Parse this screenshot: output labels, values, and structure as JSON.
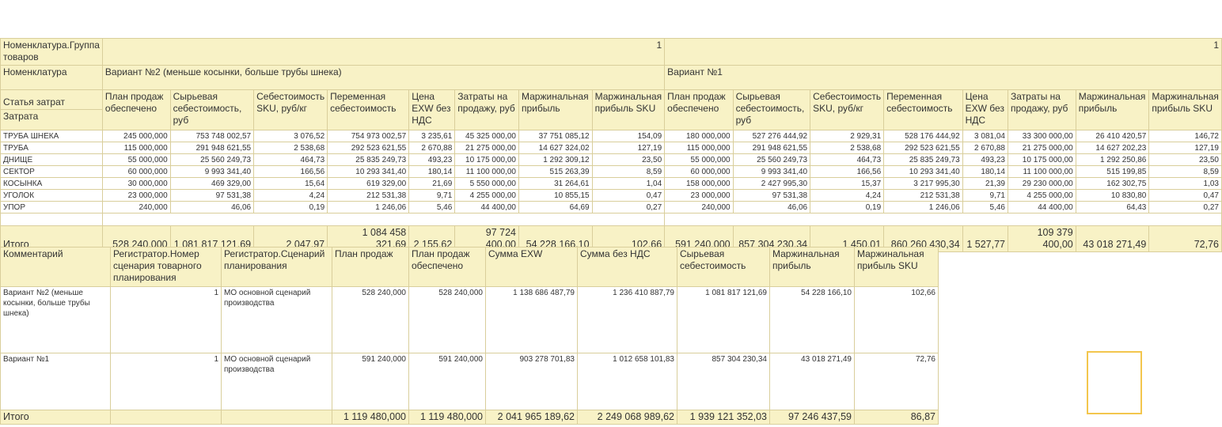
{
  "top_table": {
    "group_label": "Номенклатура.Группа товаров",
    "group_value_1": "1",
    "group_value_2": "1",
    "nomenclature_label": "Номенклатура",
    "variant_1": "Вариант №2 (меньше косынки, больше трубы шнека)",
    "variant_2": "Вариант №1",
    "stat_label": "Статья затрат",
    "zatrata_label": "Затрата",
    "col_headers": [
      "План продаж обеспечено",
      "Сырьевая себестоимость, руб",
      "Себестоимость SKU, руб/кг",
      "Переменная себестоимость",
      "Цена EXW без НДС",
      "Затраты на продажу, руб",
      "Маржинальная прибыль",
      "Маржинальная прибыль SKU"
    ],
    "rows": [
      {
        "name": "ТРУБА ШНЕКА",
        "v1": [
          "245 000,000",
          "753 748 002,57",
          "3 076,52",
          "754 973 002,57",
          "3 235,61",
          "45 325 000,00",
          "37 751 085,12",
          "154,09"
        ],
        "v2": [
          "180 000,000",
          "527 276 444,92",
          "2 929,31",
          "528 176 444,92",
          "3 081,04",
          "33 300 000,00",
          "26 410 420,57",
          "146,72"
        ]
      },
      {
        "name": "ТРУБА",
        "v1": [
          "115 000,000",
          "291 948 621,55",
          "2 538,68",
          "292 523 621,55",
          "2 670,88",
          "21 275 000,00",
          "14 627 324,02",
          "127,19"
        ],
        "v2": [
          "115 000,000",
          "291 948 621,55",
          "2 538,68",
          "292 523 621,55",
          "2 670,88",
          "21 275 000,00",
          "14 627 202,23",
          "127,19"
        ]
      },
      {
        "name": "ДНИЩЕ",
        "v1": [
          "55 000,000",
          "25 560 249,73",
          "464,73",
          "25 835 249,73",
          "493,23",
          "10 175 000,00",
          "1 292 309,12",
          "23,50"
        ],
        "v2": [
          "55 000,000",
          "25 560 249,73",
          "464,73",
          "25 835 249,73",
          "493,23",
          "10 175 000,00",
          "1 292 250,86",
          "23,50"
        ]
      },
      {
        "name": "СЕКТОР",
        "v1": [
          "60 000,000",
          "9 993 341,40",
          "166,56",
          "10 293 341,40",
          "180,14",
          "11 100 000,00",
          "515 263,39",
          "8,59"
        ],
        "v2": [
          "60 000,000",
          "9 993 341,40",
          "166,56",
          "10 293 341,40",
          "180,14",
          "11 100 000,00",
          "515 199,85",
          "8,59"
        ]
      },
      {
        "name": "КОСЫНКА",
        "v1": [
          "30 000,000",
          "469 329,00",
          "15,64",
          "619 329,00",
          "21,69",
          "5 550 000,00",
          "31 264,61",
          "1,04"
        ],
        "v2": [
          "158 000,000",
          "2 427 995,30",
          "15,37",
          "3 217 995,30",
          "21,39",
          "29 230 000,00",
          "162 302,75",
          "1,03"
        ]
      },
      {
        "name": "УГОЛОК",
        "v1": [
          "23 000,000",
          "97 531,38",
          "4,24",
          "212 531,38",
          "9,71",
          "4 255 000,00",
          "10 855,15",
          "0,47"
        ],
        "v2": [
          "23 000,000",
          "97 531,38",
          "4,24",
          "212 531,38",
          "9,71",
          "4 255 000,00",
          "10 830,80",
          "0,47"
        ]
      },
      {
        "name": "УПОР",
        "v1": [
          "240,000",
          "46,06",
          "0,19",
          "1 246,06",
          "5,46",
          "44 400,00",
          "64,69",
          "0,27"
        ],
        "v2": [
          "240,000",
          "46,06",
          "0,19",
          "1 246,06",
          "5,46",
          "44 400,00",
          "64,43",
          "0,27"
        ]
      }
    ],
    "total_label": "Итого",
    "total_v1": [
      "528 240,000",
      "1 081 817 121,69",
      "2 047,97",
      "1 084 458 321,69",
      "2 155,62",
      "97 724 400,00",
      "54 228 166,10",
      "102,66"
    ],
    "total_v2": [
      "591 240,000",
      "857 304 230,34",
      "1 450,01",
      "860 260 430,34",
      "1 527,77",
      "109 379 400,00",
      "43 018 271,49",
      "72,76"
    ]
  },
  "bottom_table": {
    "headers": [
      "Комментарий",
      "Регистратор.Номер сценария товарного планирования",
      "Регистратор.Сценарий планирования",
      "План продаж",
      "План продаж обеспечено",
      "Сумма EXW",
      "Сумма без НДС",
      "Сырьевая себестоимость",
      "Маржинальная прибыль",
      "Маржинальная прибыль SKU"
    ],
    "rows": [
      [
        "Вариант №2 (меньше косынки, больше трубы шнека)",
        "1",
        "МО основной сценарий производства",
        "528 240,000",
        "528 240,000",
        "1 138 686 487,79",
        "1 236 410 887,79",
        "1 081 817 121,69",
        "54 228 166,10",
        "102,66"
      ],
      [
        "Вариант №1",
        "1",
        "МО основной сценарий производства",
        "591 240,000",
        "591 240,000",
        "903 278 701,83",
        "1 012 658 101,83",
        "857 304 230,34",
        "43 018 271,49",
        "72,76"
      ]
    ],
    "total_label": "Итого",
    "totals": [
      "1 119 480,000",
      "1 119 480,000",
      "2 041 965 189,62",
      "2 249 068 989,62",
      "1 939 121 352,03",
      "97 246 437,59",
      "86,87"
    ]
  }
}
